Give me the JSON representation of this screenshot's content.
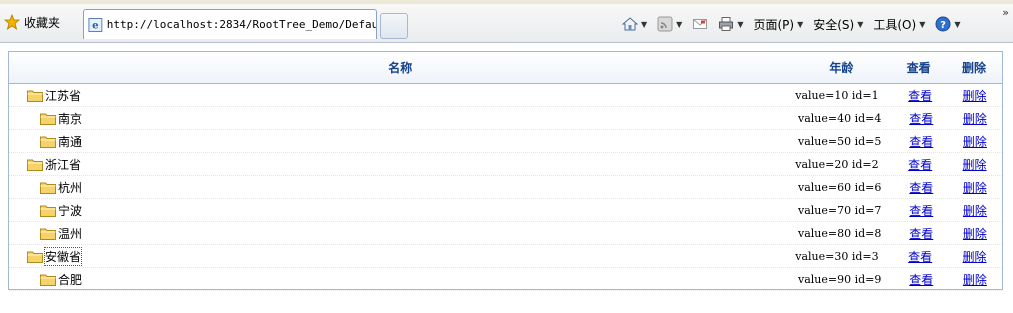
{
  "browser": {
    "favorites_label": "收藏夹",
    "tab_url": "http://localhost:2834/RootTree_Demo/Defau...",
    "commands": [
      {
        "label": "",
        "icon": "home-icon"
      },
      {
        "label": "",
        "icon": "rss-icon"
      },
      {
        "label": "",
        "icon": "mail-icon"
      },
      {
        "label": "",
        "icon": "print-icon"
      },
      {
        "label": "页面(P)",
        "icon": ""
      },
      {
        "label": "安全(S)",
        "icon": ""
      },
      {
        "label": "工具(O)",
        "icon": ""
      },
      {
        "label": "",
        "icon": "help-icon"
      }
    ],
    "chevron": "»"
  },
  "colors": {
    "header_text": "#15428b",
    "link": "#0000cc",
    "border": "#a4b8d4",
    "folder": "#f5d36a"
  },
  "grid": {
    "headers": {
      "name": "名称",
      "age": "年龄",
      "view": "查看",
      "delete": "删除"
    },
    "rows": [
      {
        "name": "江苏省",
        "level": 0,
        "value": "value=10 id=1",
        "view": "查看",
        "delete": "删除"
      },
      {
        "name": "南京",
        "level": 1,
        "value": "value=40 id=4",
        "view": "查看",
        "delete": "删除"
      },
      {
        "name": "南通",
        "level": 1,
        "value": "value=50 id=5",
        "view": "查看",
        "delete": "删除"
      },
      {
        "name": "浙江省",
        "level": 0,
        "value": "value=20 id=2",
        "view": "查看",
        "delete": "删除"
      },
      {
        "name": "杭州",
        "level": 1,
        "value": "value=60 id=6",
        "view": "查看",
        "delete": "删除"
      },
      {
        "name": "宁波",
        "level": 1,
        "value": "value=70 id=7",
        "view": "查看",
        "delete": "删除"
      },
      {
        "name": "温州",
        "level": 1,
        "value": "value=80 id=8",
        "view": "查看",
        "delete": "删除"
      },
      {
        "name": "安徽省",
        "level": 0,
        "value": "value=30 id=3",
        "view": "查看",
        "delete": "删除",
        "selected": true
      },
      {
        "name": "合肥",
        "level": 1,
        "value": "value=90 id=9",
        "view": "查看",
        "delete": "删除"
      }
    ]
  }
}
